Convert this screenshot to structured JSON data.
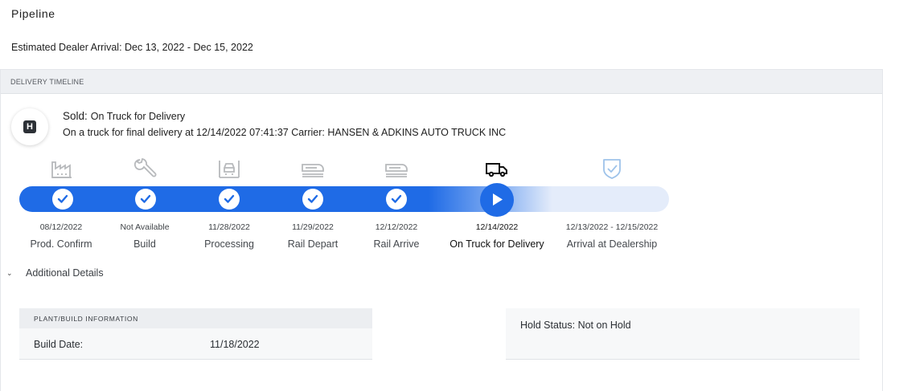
{
  "page": {
    "title": "Pipeline",
    "eta": "Estimated Dealer Arrival: Dec 13, 2022 - Dec 15, 2022"
  },
  "timeline": {
    "header": "DELIVERY TIMELINE",
    "badge_letter": "H",
    "sold_label": "Sold:",
    "status": "On Truck for Delivery",
    "description": "On a truck for final delivery at 12/14/2022 07:41:37 Carrier: HANSEN & ADKINS AUTO TRUCK INC",
    "stages": [
      {
        "date": "08/12/2022",
        "name": "Prod. Confirm",
        "icon": "factory-icon",
        "state": "complete"
      },
      {
        "date": "Not Available",
        "name": "Build",
        "icon": "wrench-icon",
        "state": "complete"
      },
      {
        "date": "11/28/2022",
        "name": "Processing",
        "icon": "car-processing-icon",
        "state": "complete"
      },
      {
        "date": "11/29/2022",
        "name": "Rail Depart",
        "icon": "train-icon",
        "state": "complete"
      },
      {
        "date": "12/12/2022",
        "name": "Rail Arrive",
        "icon": "train-icon",
        "state": "complete"
      },
      {
        "date": "12/14/2022",
        "name": "On Truck for Delivery",
        "icon": "truck-icon",
        "state": "current"
      },
      {
        "date": "12/13/2022 - 12/15/2022",
        "name": "Arrival at Dealership",
        "icon": "shield-check-icon",
        "state": "pending"
      }
    ],
    "colors": {
      "accent": "#1f6be6",
      "track_pending": "#e4ecfa",
      "icon_inactive": "#b7b9bc",
      "icon_pending": "#9ec3ea"
    }
  },
  "details": {
    "toggle_label": "Additional Details",
    "plant": {
      "header": "PLANT/BUILD INFORMATION",
      "build_date_label": "Build Date:",
      "build_date_value": "11/18/2022"
    },
    "hold_status": "Hold Status: Not on Hold"
  }
}
